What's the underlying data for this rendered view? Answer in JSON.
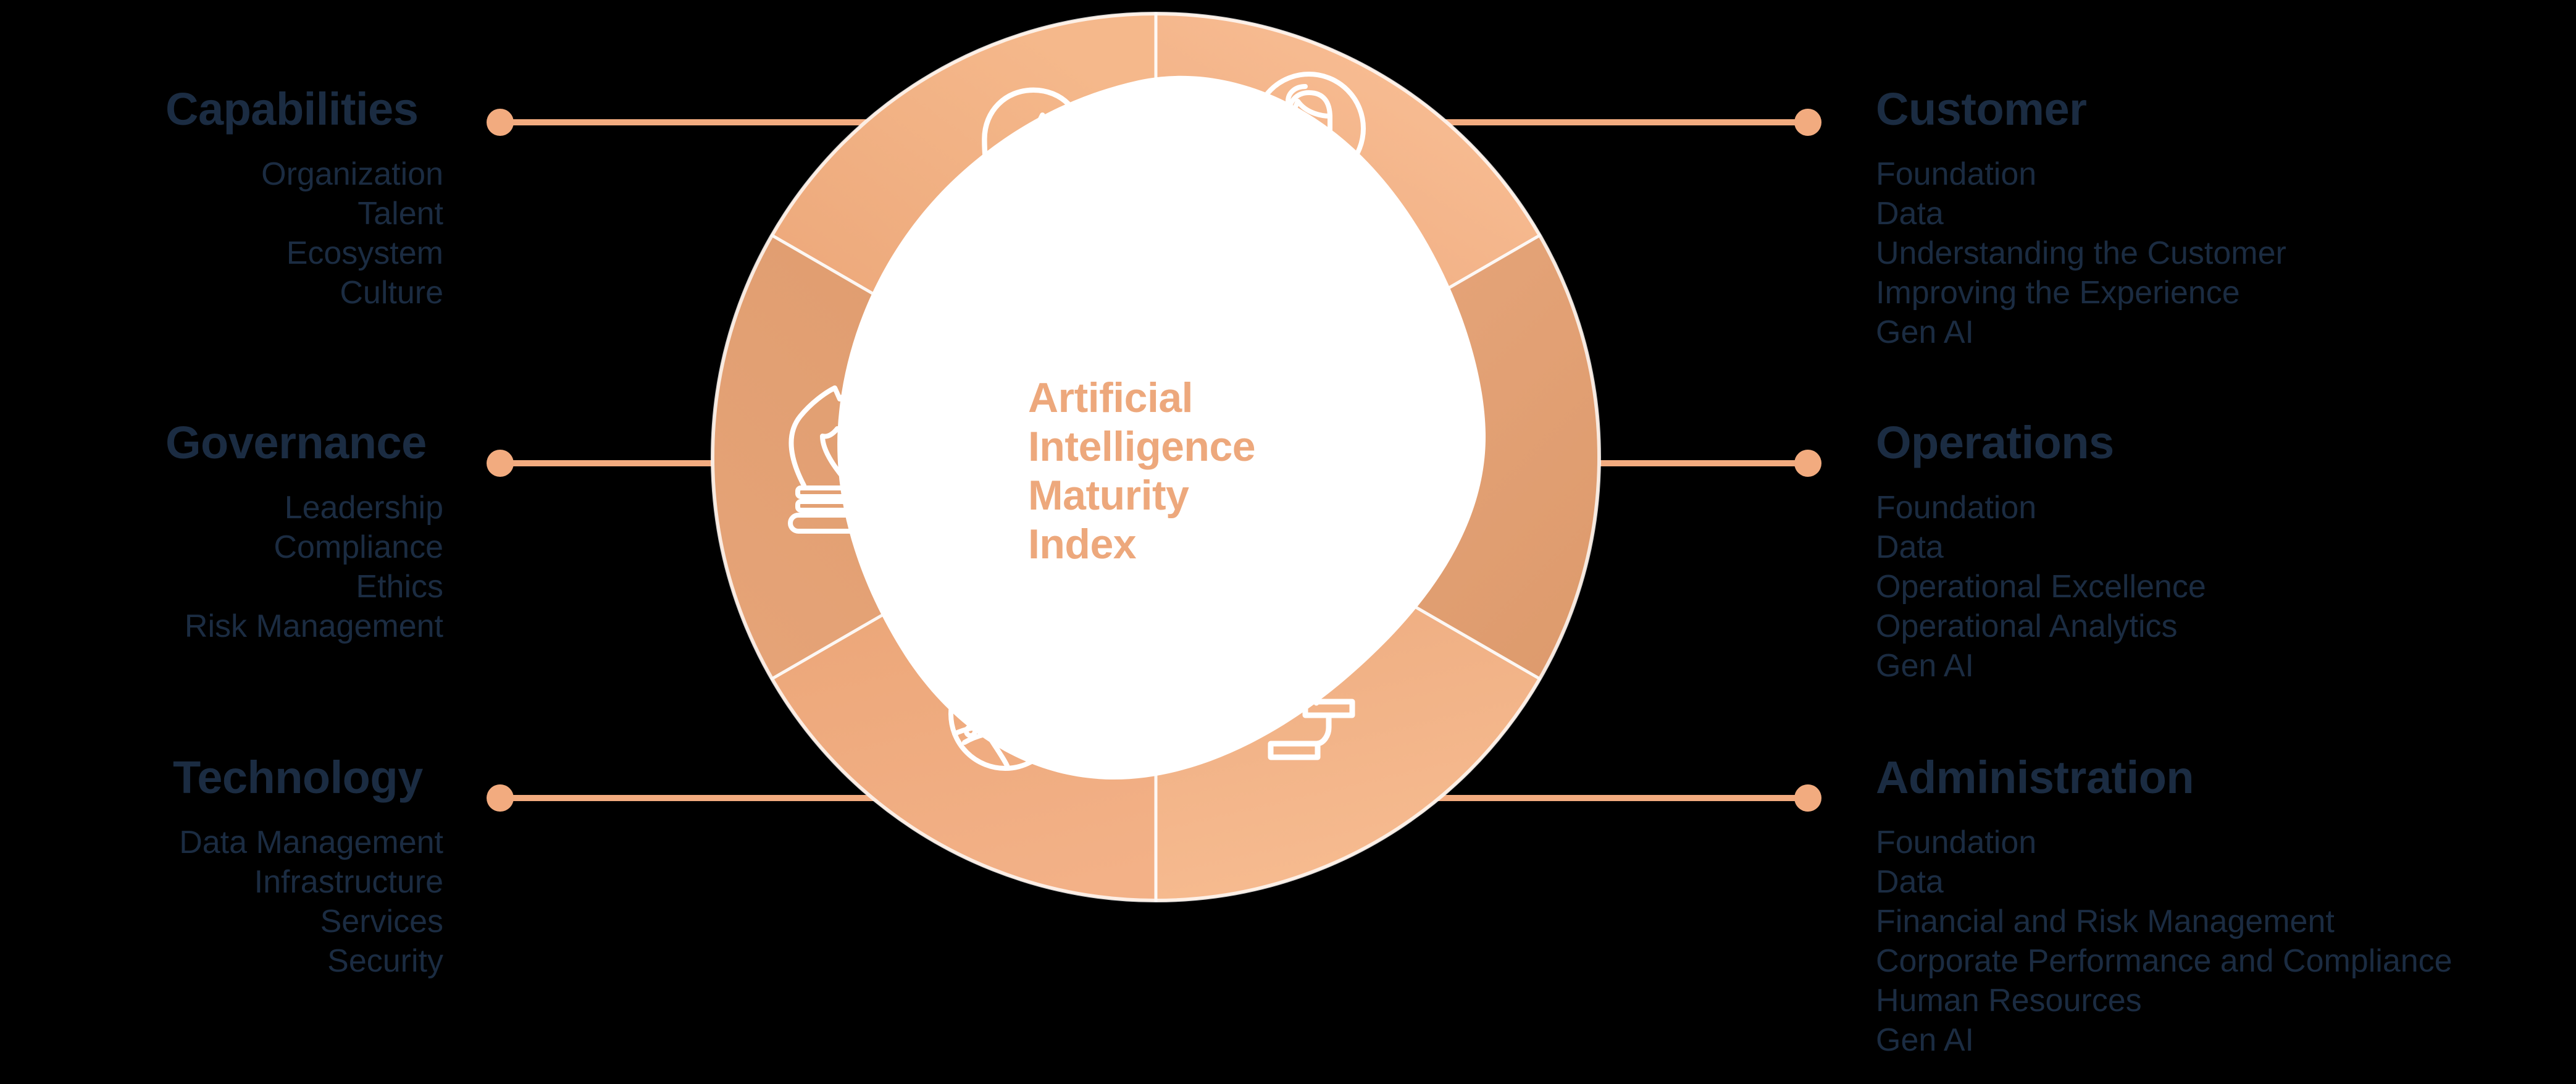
{
  "center": {
    "title_lines": [
      "Artificial",
      "Intelligence",
      "Maturity",
      "Index"
    ],
    "text_color": "#eda87c",
    "shape_fill": "#ffffff"
  },
  "palette": {
    "background": "#000000",
    "connector": "#f2ab7f",
    "heading_text": "#1b2c42",
    "item_text": "#1b2c42",
    "segment_light": "#f6b98c",
    "segment_mid": "#efa878",
    "segment_dark": "#dd9a6c",
    "divider": "#ffffff"
  },
  "categories": [
    {
      "id": "capabilities",
      "title": "Capabilities",
      "side": "left",
      "icon": "head-lightning-icon",
      "items": [
        "Organization",
        "Talent",
        "Ecosystem",
        "Culture"
      ]
    },
    {
      "id": "governance",
      "title": "Governance",
      "side": "left",
      "icon": "chess-knight-icon",
      "items": [
        "Leadership",
        "Compliance",
        "Ethics",
        "Risk Management"
      ]
    },
    {
      "id": "technology",
      "title": "Technology",
      "side": "left",
      "icon": "globe-network-icon",
      "items": [
        "Data Management",
        "Infrastructure",
        "Services",
        "Security"
      ]
    },
    {
      "id": "customer",
      "title": "Customer",
      "side": "right",
      "icon": "person-avatar-icon",
      "items": [
        "Foundation",
        "Data",
        "Understanding the Customer",
        "Improving the Experience",
        "Gen AI"
      ]
    },
    {
      "id": "operations",
      "title": "Operations",
      "side": "right",
      "icon": "flowchart-icon",
      "items": [
        "Foundation",
        "Data",
        "Operational Excellence",
        "Operational Analytics",
        "Gen AI"
      ]
    },
    {
      "id": "administration",
      "title": "Administration",
      "side": "right",
      "icon": "gantt-chart-icon",
      "items": [
        "Foundation",
        "Data",
        "Financial and Risk Management",
        "Corporate Performance and Compliance",
        "Human Resources",
        "Gen AI"
      ]
    }
  ]
}
